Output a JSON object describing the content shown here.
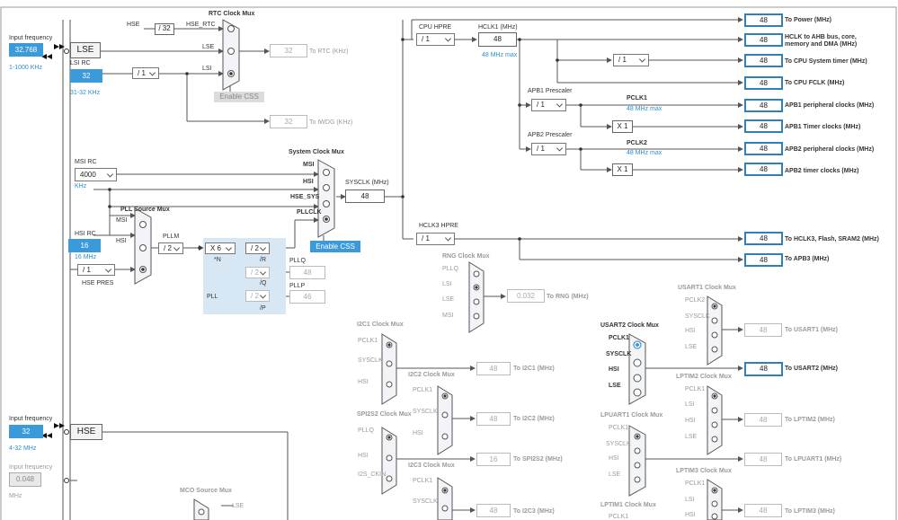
{
  "colors": {
    "accent": "#3b9ad9",
    "active_border": "#2f7fb8",
    "wire": "#555555",
    "pll_area": "#d7e7f4"
  },
  "rtc": {
    "mux_title": "RTC Clock Mux",
    "in_hse": "HSE",
    "div32": "/ 32",
    "in_hse_rtc": "HSE_RTC",
    "in_lse": "LSE",
    "in_lsi": "LSI",
    "value": "32",
    "out": "To RTC (KHz)",
    "css": "Enable CSS"
  },
  "iwdg": {
    "value": "32",
    "out": "To IWDG (KHz)"
  },
  "lse": {
    "input_label": "Input frequency",
    "input_value": "32.768",
    "range": "1-1000 KHz",
    "name": "LSE"
  },
  "lsi": {
    "name": "LSI RC",
    "value": "32",
    "range": "31-32 KHz",
    "div": "/ 1"
  },
  "msi": {
    "name": "MSI RC",
    "value": "4000",
    "unit": "KHz"
  },
  "hsi": {
    "name": "HSI RC",
    "value": "16",
    "unit": "16 MHz"
  },
  "hse_pres": {
    "value": "/ 1",
    "label": "HSE PRES"
  },
  "pll_mux": {
    "title": "PLL Source Mux",
    "in_msi": "MSI",
    "in_hsi": "HSI"
  },
  "pll": {
    "m_label": "PLLM",
    "m_value": "/ 2",
    "n_value": "X 6",
    "n_label": "*N",
    "r_value": "/ 2",
    "r_label": "/R",
    "q_value": "/ 2",
    "q_label": "/Q",
    "p_value": "/ 2",
    "p_label": "/P",
    "name": "PLL",
    "pllq": "PLLQ",
    "pllq_value": "48",
    "pllp": "PLLP",
    "pllp_value": "46"
  },
  "sys_mux": {
    "title": "System Clock Mux",
    "in_msi": "MSI",
    "in_hsi": "HSI",
    "in_hse_sys": "HSE_SYS",
    "in_pllclk": "PLLCLK",
    "sysclk_label": "SYSCLK (MHz)",
    "sysclk_value": "48",
    "css": "Enable CSS"
  },
  "cpu": {
    "hpre_label": "CPU HPRE",
    "hpre_value": "/ 1",
    "hclk1_label": "HCLK1 (MHz)",
    "hclk1_value": "48",
    "hclk1_max": "48 MHz max"
  },
  "outputs": {
    "power_value": "48",
    "power": "To Power (MHz)",
    "ahb_value": "48",
    "ahb_1": "HCLK to AHB bus, core,",
    "ahb_2": "memory and DMA (MHz)",
    "systimer_div": "/ 1",
    "systimer_value": "48",
    "systimer": "To CPU System timer (MHz)",
    "fclk_value": "48",
    "fclk": "To CPU FCLK (MHz)"
  },
  "apb1": {
    "prescaler": "APB1 Prescaler",
    "div": "/ 1",
    "pclk": "PCLK1",
    "max": "48 MHz max",
    "periph_value": "48",
    "periph": "APB1 peripheral clocks (MHz)",
    "timer_mult": "X 1",
    "timer_value": "48",
    "timer": "APB1 Timer clocks (MHz)"
  },
  "apb2": {
    "prescaler": "APB2 Prescaler",
    "div": "/ 1",
    "pclk": "PCLK2",
    "max": "48 MHz max",
    "periph_value": "48",
    "periph": "APB2 peripheral clocks (MHz)",
    "timer_mult": "X 1",
    "timer_value": "48",
    "timer": "APB2 timer clocks (MHz)"
  },
  "hclk3": {
    "label": "HCLK3 HPRE",
    "div": "/ 1",
    "value": "48",
    "out": "To HCLK3, Flash, SRAM2 (MHz)",
    "apb3_value": "48",
    "apb3": "To APB3 (MHz)"
  },
  "rng": {
    "title": "RNG Clock Mux",
    "in_pllq": "PLLQ",
    "in_lsi": "LSI",
    "in_lse": "LSE",
    "in_msi": "MSI",
    "value": "0.032",
    "out": "To RNG (MHz)"
  },
  "i2c1": {
    "title": "I2C1 Clock Mux",
    "in_pclk": "PCLK1",
    "in_sysclk": "SYSCLK",
    "in_hsi": "HSI",
    "value": "48",
    "out": "To I2C1 (MHz)"
  },
  "i2c2": {
    "title": "I2C2 Clock Mux",
    "in_pclk": "PCLK1",
    "in_sysclk": "SYSCLK",
    "in_hsi": "HSI",
    "value": "48",
    "out": "To I2C2 (MHz)"
  },
  "spi2s2": {
    "title": "SPI2S2 Clock Mux",
    "in_pllq": "PLLQ",
    "in_hsi": "HSI",
    "in_i2s": "I2S_CKIN",
    "value": "16",
    "out": "To SPI2S2 (MHz)"
  },
  "i2c3": {
    "title": "I2C3 Clock Mux",
    "in_pclk": "PCLK1",
    "in_sysclk": "SYSCLK",
    "value": "48",
    "out": "To I2C3 (MHz)"
  },
  "usart1": {
    "title": "USART1 Clock Mux",
    "in_pclk": "PCLK2",
    "in_sysclk": "SYSCLK",
    "in_hsi": "HSI",
    "in_lse": "LSE",
    "value": "48",
    "out": "To USART1 (MHz)"
  },
  "usart2": {
    "title": "USART2 Clock Mux",
    "in_pclk": "PCLK1",
    "in_sysclk": "SYSCLK",
    "in_hsi": "HSI",
    "in_lse": "LSE",
    "value": "48",
    "out": "To USART2 (MHz)"
  },
  "lptim2": {
    "title": "LPTIM2 Clock Mux",
    "in_pclk": "PCLK1",
    "in_lsi": "LSI",
    "in_hsi": "HSI",
    "in_lse": "LSE",
    "value": "48",
    "out": "To LPTIM2 (MHz)"
  },
  "lpuart1": {
    "title": "LPUART1 Clock Mux",
    "in_pclk": "PCLK1",
    "in_sysclk": "SYSCLK",
    "in_hsi": "HSI",
    "in_lse": "LSE",
    "value": "48",
    "out": "To LPUART1 (MHz)"
  },
  "lptim3": {
    "title": "LPTIM3 Clock Mux",
    "in_pclk": "PCLK1",
    "in_lsi": "LSI",
    "in_hsi": "HSI",
    "value": "48",
    "out": "To LPTIM3 (MHz)"
  },
  "lptim1": {
    "title": "LPTIM1 Clock Mux",
    "in_pclk": "PCLK1"
  },
  "hse": {
    "input_label": "Input frequency",
    "input_value": "32",
    "range": "4-32 MHz",
    "name": "HSE"
  },
  "ext": {
    "input_label": "Input frequency",
    "input_value": "0.048",
    "unit": "MHz"
  },
  "mco": {
    "title": "MCO Source Mux",
    "in_lse": "LSE"
  }
}
